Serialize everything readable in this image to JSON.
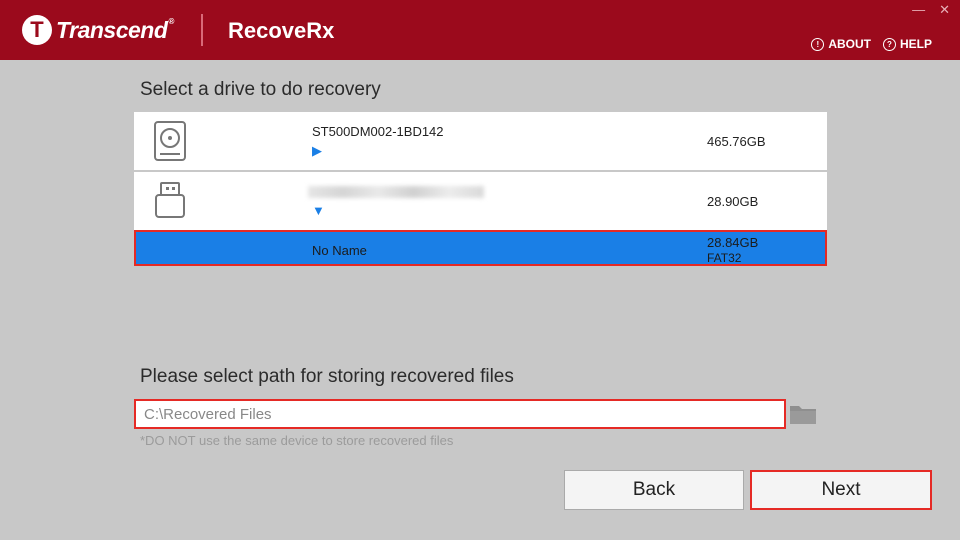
{
  "header": {
    "brand": "Transcend",
    "brand_mark": "T",
    "brand_reg": "®",
    "app_title": "RecoveRx",
    "about_label": "ABOUT",
    "help_label": "HELP",
    "minimize_glyph": "—",
    "close_glyph": "✕"
  },
  "drive_section": {
    "title": "Select a drive to do recovery",
    "drives": [
      {
        "name": "ST500DM002-1BD142",
        "size": "465.76GB",
        "icon": "hard-drive-icon",
        "arrow": "▶"
      },
      {
        "name": "",
        "size": "28.90GB",
        "icon": "usb-drive-icon",
        "arrow": "▼"
      }
    ],
    "partition": {
      "name": "No Name",
      "size": "28.84GB",
      "filesystem": "FAT32"
    }
  },
  "path_section": {
    "title": "Please select path for storing recovered files",
    "path_value": "C:\\Recovered Files",
    "warning": "*DO NOT use the same device to store recovered files"
  },
  "buttons": {
    "back": "Back",
    "next": "Next"
  },
  "colors": {
    "header": "#9b0a1c",
    "accent": "#1a7fe6",
    "highlight": "#e52a25",
    "background": "#c8c8c8"
  }
}
